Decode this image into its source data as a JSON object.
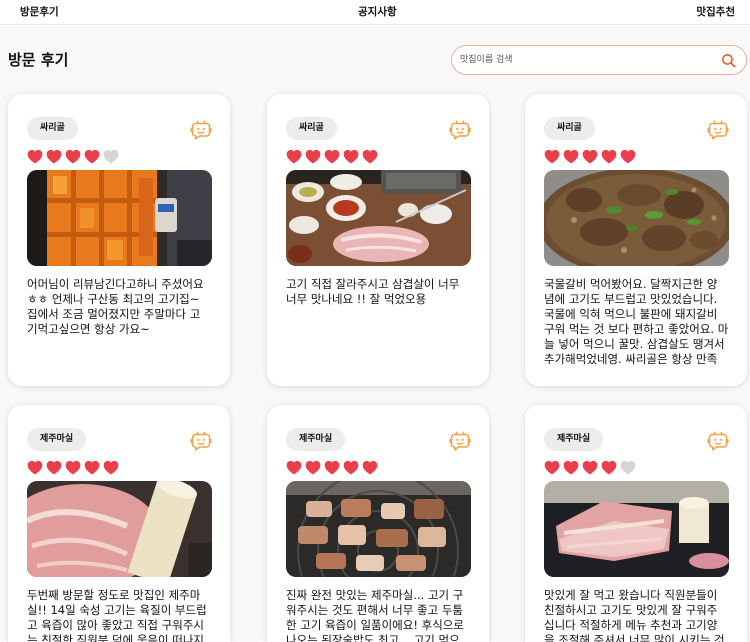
{
  "nav": {
    "items": [
      "방문후기",
      "공지사항",
      "맛집추천"
    ]
  },
  "page": {
    "title": "방문 후기"
  },
  "search": {
    "placeholder": "맛집이름 검색",
    "icon": "search-icon"
  },
  "colors": {
    "accent": "#ef5a2f",
    "heart": "#ea3f4b",
    "heart_empty": "#d5d5d5",
    "card_icon": "#f5a142",
    "search_border": "#f3aa9e",
    "badge_bg": "#ececec"
  },
  "icons": {
    "card_action": "chat-face-icon",
    "rating": "heart-icon"
  },
  "rating_max": 5,
  "reviews": [
    {
      "store": "싸리골",
      "rating": 4,
      "lines": [
        "어머님이 리뷰남긴다고하니 주셨어요",
        "ㅎㅎ 언제나 구산동 최고의 고기집~",
        "집에서 조금 멀어졌지만 주말마다 고",
        "기먹고싶으면 항상 가요~"
      ]
    },
    {
      "store": "싸리골",
      "rating": 5,
      "lines": [
        "고기 직접 잘라주시고 삼겹살이 너무",
        "너무 맛나네요 !! 잘 먹었오용"
      ]
    },
    {
      "store": "싸리골",
      "rating": 5,
      "lines": [
        "국물갈비 먹어봤어요. 달짝지근한 양",
        "념에 고기도 부드럽고 맛있었습니다.",
        "국물에 익혀 먹으니 불판에 돼지갈비",
        "구워 먹는 것 보다 편하고 좋았어요. 마",
        "늘 넣어 먹으니 꿀맛. 삼겹살도 땡겨서",
        "추가해먹었네영. 싸리골은 항상 만족"
      ]
    },
    {
      "store": "제주마실",
      "rating": 5,
      "lines": [
        "두번째 방문할 정도로 맛집인 제주마",
        "실!! 14일 숙성 고기는 육질이 부드럽",
        "고 육즙이 많아 좋았고 직접 구워주시",
        "는 친절한 직원분 덕에 웃음이 떠나지"
      ]
    },
    {
      "store": "제주마실",
      "rating": 5,
      "lines": [
        "진짜 완전 맛있는 제주마실... 고기 구",
        "워주시는 것도 편해서 너무 좋고 두툼",
        "한 고기 육즙이 일품이에요! 후식으로",
        "나오는 된장술밥도 최고... 고기 먹으"
      ]
    },
    {
      "store": "제주마실",
      "rating": 4,
      "lines": [
        "맛있게 잘 먹고 왔습니다 직원분들이",
        "친절하시고 고기도 맛있게 잘 구워주",
        "십니다 적절하게 메뉴 추천과 고기양",
        "을 조절해 주셔서 너무 많이 시키는 것"
      ]
    }
  ]
}
